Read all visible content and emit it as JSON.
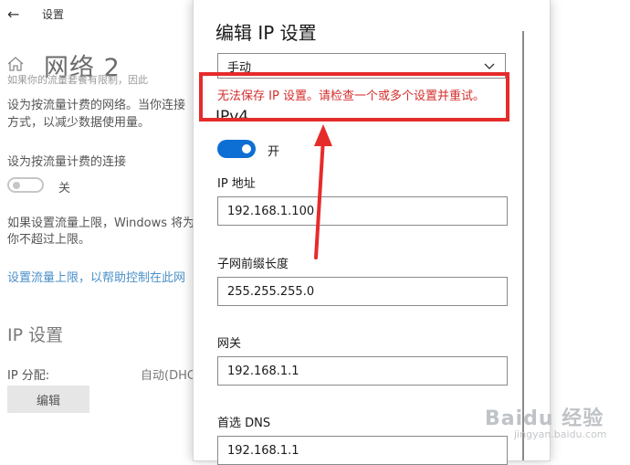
{
  "app": {
    "title": "设置"
  },
  "page": {
    "title": "网络 2",
    "para1": [
      "如果你的流量套餐有限制，因此",
      "设为按流量计费的网络。当你连接",
      "方式，以减少数据使用量。"
    ],
    "metered_label": "设为按流量计费的连接",
    "metered_state": "关",
    "para2": [
      "如果设置流量上限，Windows 将为",
      "你不超过上限。"
    ],
    "limit_link": "设置流量上限，以帮助控制在此网",
    "ip_section": "IP 设置",
    "ip_assign_label": "IP 分配:",
    "ip_assign_value": "自动(DHC",
    "edit_button": "编辑"
  },
  "dialog": {
    "title": "编辑 IP 设置",
    "mode_value": "手动",
    "error_message": "无法保存 IP 设置。请检查一个或多个设置并重试。",
    "ipv4_heading": "IPv4",
    "ipv4_toggle_label": "开",
    "fields": {
      "ip_label": "IP 地址",
      "ip_value": "192.168.1.100",
      "prefix_label": "子网前缀长度",
      "prefix_value": "255.255.255.0",
      "gateway_label": "网关",
      "gateway_value": "192.168.1.1",
      "dns_label": "首选 DNS",
      "dns_value": "192.168.1.1"
    }
  },
  "watermark": {
    "brand": "Baidu 经验",
    "url": "jingyan.baidu.com"
  },
  "colors": {
    "accent": "#0d6fd4",
    "error": "#d62c2c",
    "annotation": "#e62b2b",
    "link": "#4a90c9"
  },
  "icons": [
    "back-arrow-icon",
    "home-icon",
    "chevron-down-icon",
    "arrow-annotation"
  ]
}
